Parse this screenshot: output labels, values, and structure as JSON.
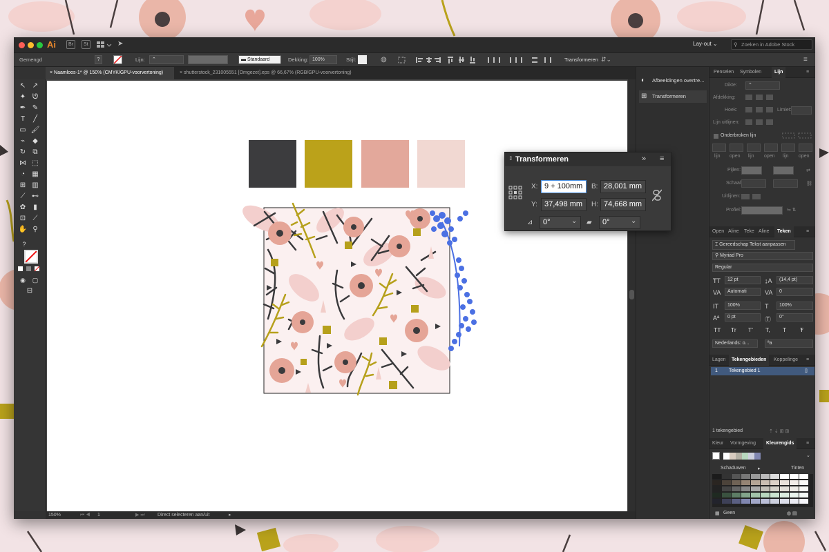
{
  "window": {
    "app_logo": "Ai",
    "app_icons": [
      "Br",
      "St"
    ],
    "workspace": "Lay-out",
    "search_placeholder": "Zoeken in Adobe Stock"
  },
  "control_bar": {
    "blend_mode": "Gemengd",
    "stroke_label": "Lijn:",
    "stroke_profile": "Standaard",
    "opacity_label": "Dekking:",
    "opacity_value": "100%",
    "style_label": "Stijl:",
    "transform_label": "Transformeren"
  },
  "document_tabs": [
    {
      "label": "Naamloos-1* @ 150% (CMYK/GPU-voorvertoning)",
      "active": true
    },
    {
      "label": "shutterstock_231005551 [Omgezet].eps @ 66,67% (RGB/GPU-voorvertoning)",
      "active": false
    }
  ],
  "palette_colors": [
    "#3c3c3e",
    "#bba21a",
    "#e3a89b",
    "#f1d8d2"
  ],
  "pattern_bg": "#fbf0f0",
  "transform_panel": {
    "title": "Transformeren",
    "x_label": "X:",
    "x_value": "9 + 100mm",
    "y_label": "Y:",
    "y_value": "37,498 mm",
    "w_label": "B:",
    "w_value": "28,001 mm",
    "h_label": "H:",
    "h_value": "74,668 mm",
    "rotate_value": "0°",
    "shear_value": "0°"
  },
  "dock": {
    "items": [
      "Afbeeldingen overtre...",
      "Transformeren"
    ]
  },
  "stroke_panel": {
    "tabs": [
      "Penselen",
      "Symbolen",
      "Lijn"
    ],
    "weight_label": "Dikte:",
    "cap_label": "Afdekking:",
    "corner_label": "Hoek:",
    "limit_label": "Limiet:",
    "align_label": "Lijn uitlijnen:",
    "dashed_label": "Onderbroken lijn",
    "dash_labels": [
      "lijn",
      "open",
      "lijn",
      "open",
      "lijn",
      "open"
    ],
    "arrows_label": "Pijlen:",
    "scale_label": "Schaal:",
    "align2_label": "Uitlijnen:",
    "profile_label": "Profiel:"
  },
  "character_panel": {
    "tabs": [
      "Open",
      "Aline",
      "Teke",
      "Aline",
      "Teken"
    ],
    "touch_button": "Gereedschap Tekst aanpassen",
    "font": "Myriad Pro",
    "style": "Regular",
    "size": "12 pt",
    "leading": "(14,4 pt)",
    "kerning": "Automati",
    "tracking": "0",
    "vscale": "100%",
    "hscale": "100%",
    "baseline": "0 pt",
    "rotation": "0°",
    "language": "Nederlands: o...",
    "caps_buttons": [
      "TT",
      "Tr",
      "T'",
      "T,",
      "T",
      "Ŧ"
    ]
  },
  "artboards_panel": {
    "tabs": [
      "Lagen",
      "Tekengebieden",
      "Koppelinge"
    ],
    "rows": [
      {
        "num": "1",
        "name": "Tekengebied 1"
      }
    ],
    "footer": "1 tekengebied"
  },
  "color_guide_panel": {
    "tabs": [
      "Kleur",
      "Vormgeving",
      "Kleurengids"
    ],
    "shades_label": "Schaduwen",
    "tints_label": "Tinten",
    "footer_label": "Geen"
  },
  "status": {
    "zoom": "150%",
    "page": "1",
    "tool_hint": "Direct selecteren aan/uit"
  }
}
